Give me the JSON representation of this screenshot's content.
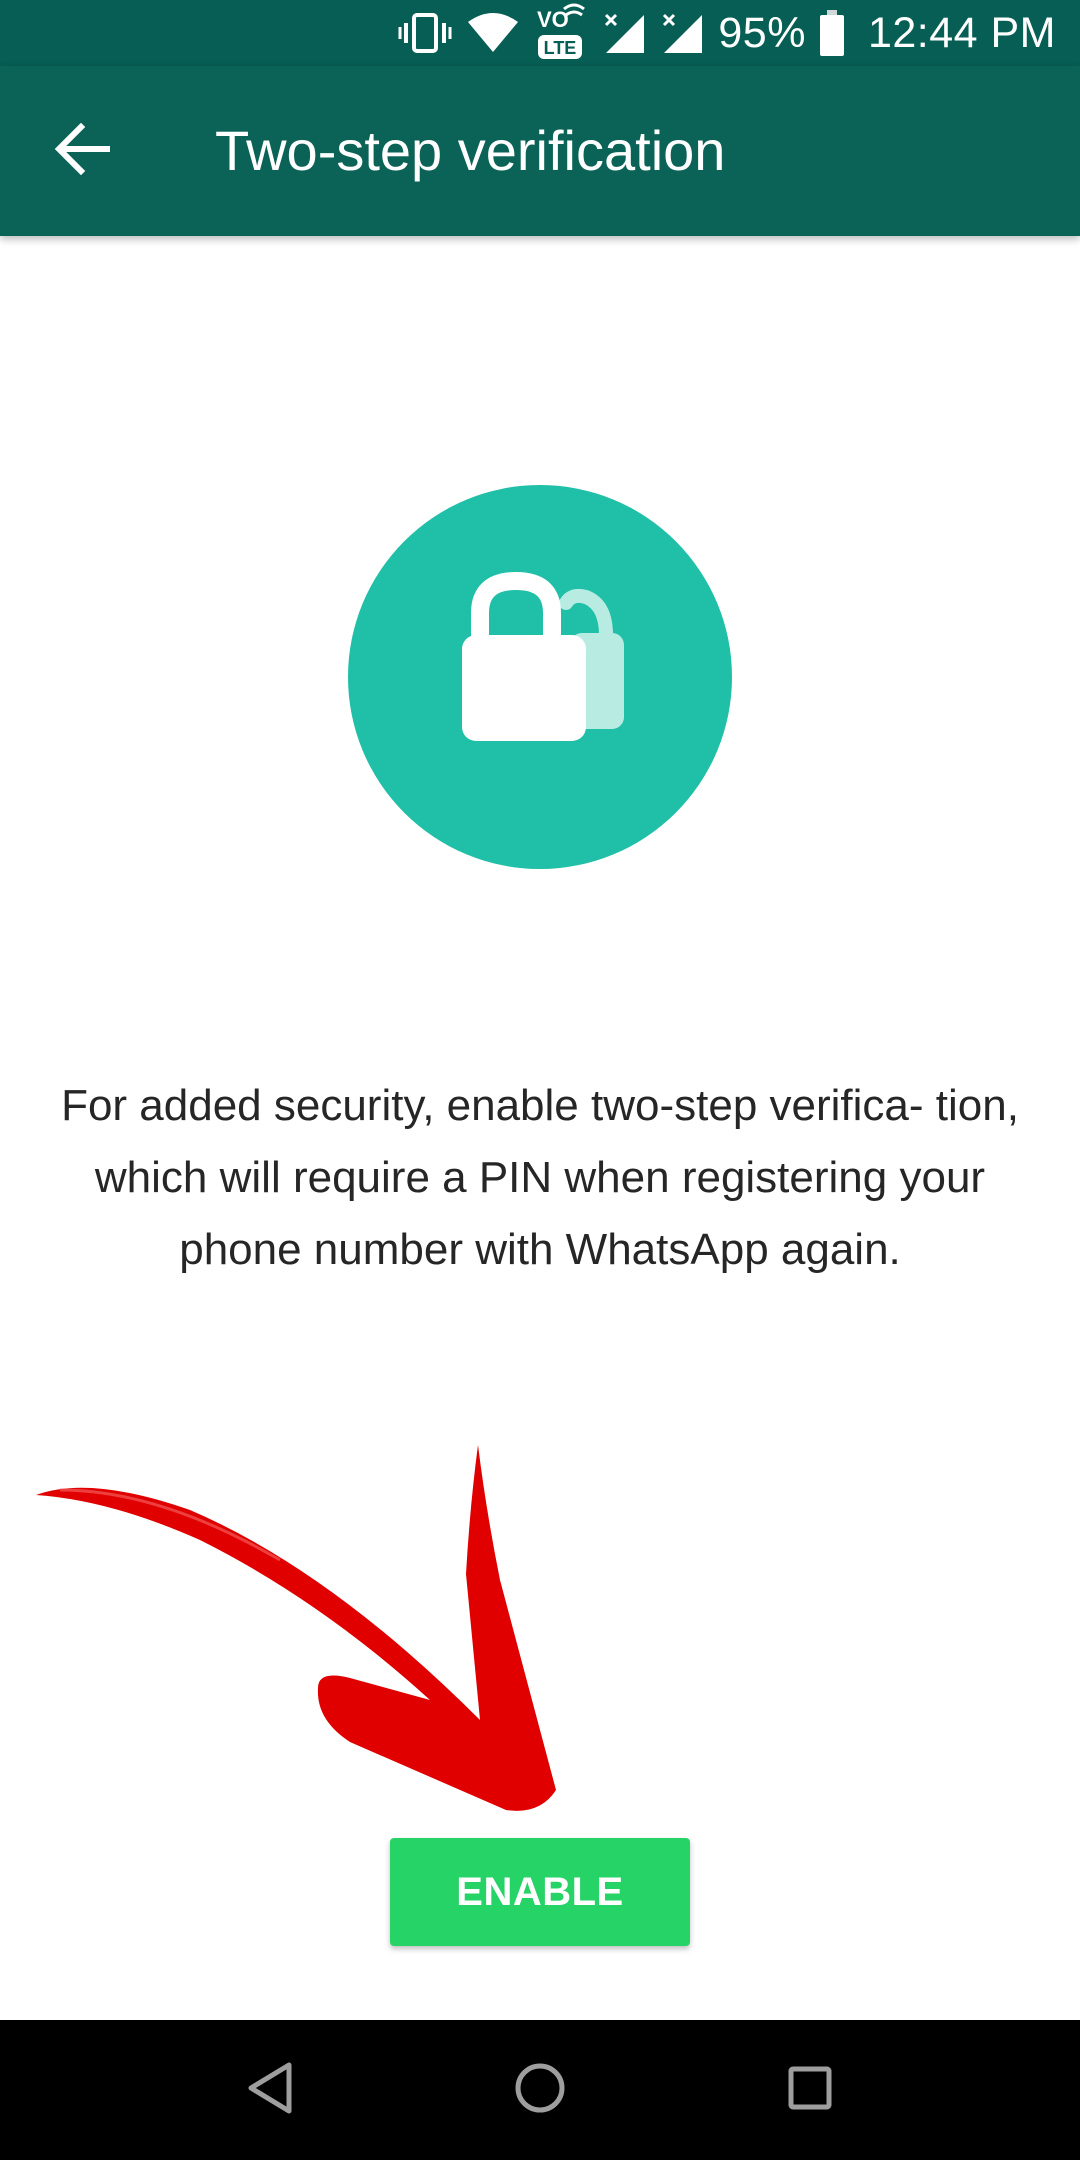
{
  "status_bar": {
    "network_badge_top": "VO",
    "network_badge_bottom": "LTE",
    "battery": "95%",
    "time": "12:44 PM",
    "icons": [
      "vibrate-icon",
      "wifi-icon",
      "volte-icon",
      "signal-icon",
      "signal-icon",
      "battery-icon"
    ]
  },
  "app_bar": {
    "title": "Two-step verification",
    "back_icon": "arrow-back-icon",
    "color": "#0b6257"
  },
  "main": {
    "illustration_icon": "lock-icon",
    "illustration_color": "#20bfa7",
    "description": "For added security, enable two-step verifica- tion, which will require a PIN when registering your phone number with WhatsApp again.",
    "enable_label": "ENABLE",
    "enable_color": "#25d366",
    "annotation_icon": "red-arrow-icon"
  },
  "nav_bar": {
    "icons": [
      "back-triangle-icon",
      "home-circle-icon",
      "recents-square-icon"
    ]
  }
}
